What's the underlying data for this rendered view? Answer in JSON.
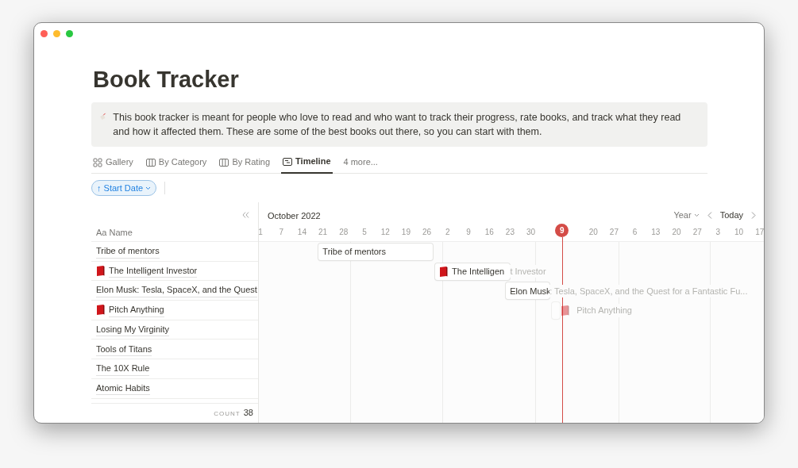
{
  "title": "Book Tracker",
  "callout": "This book tracker is meant for people who love to read and who want to track their progress, rate books, and track what they read and how it affected them. These are some of the best books out there, so you can start with them.",
  "views": [
    {
      "label": "Gallery",
      "kind": "gallery",
      "selected": false
    },
    {
      "label": "By Category",
      "kind": "board",
      "selected": false
    },
    {
      "label": "By Rating",
      "kind": "board",
      "selected": false
    },
    {
      "label": "Timeline",
      "kind": "timeline",
      "selected": true
    }
  ],
  "more_views": "4 more...",
  "sort": {
    "arrow": "↑",
    "label": "Start Date"
  },
  "name_header": {
    "icon_text": "Aa",
    "label": "Name"
  },
  "month": "October 2022",
  "scale": "Year",
  "today_button": "Today",
  "ticks": [
    {
      "label": "1",
      "today": false
    },
    {
      "label": "7",
      "today": false
    },
    {
      "label": "14",
      "today": false
    },
    {
      "label": "21",
      "today": false
    },
    {
      "label": "28",
      "today": false
    },
    {
      "label": "5",
      "today": false
    },
    {
      "label": "12",
      "today": false
    },
    {
      "label": "19",
      "today": false
    },
    {
      "label": "26",
      "today": false
    },
    {
      "label": "2",
      "today": false
    },
    {
      "label": "9",
      "today": false
    },
    {
      "label": "16",
      "today": false
    },
    {
      "label": "23",
      "today": false
    },
    {
      "label": "30",
      "today": false
    },
    {
      "label": "9",
      "today": true
    },
    {
      "label": "20",
      "today": false
    },
    {
      "label": "27",
      "today": false
    },
    {
      "label": "6",
      "today": false
    },
    {
      "label": "13",
      "today": false
    },
    {
      "label": "20",
      "today": false
    },
    {
      "label": "27",
      "today": false
    },
    {
      "label": "3",
      "today": false
    },
    {
      "label": "10",
      "today": false
    },
    {
      "label": "17",
      "today": false
    }
  ],
  "rows": [
    {
      "name": "Tribe of mentors",
      "book_icon": false
    },
    {
      "name": "The Intelligent Investor",
      "book_icon": true
    },
    {
      "name": "Elon Musk: Tesla, SpaceX, and the Quest",
      "book_icon": false
    },
    {
      "name": "Pitch Anything",
      "book_icon": true
    },
    {
      "name": "Losing My Virginity",
      "book_icon": false
    },
    {
      "name": "Tools of Titans",
      "book_icon": false
    },
    {
      "name": "The 10X Rule",
      "book_icon": false
    },
    {
      "name": "Atomic Habits",
      "book_icon": false
    }
  ],
  "bars": [
    {
      "inside": "Tribe of mentors",
      "book_icon": false,
      "faded": false
    },
    {
      "inside": "The Intelligen",
      "outside": "t Investor",
      "book_icon": true,
      "faded": false
    },
    {
      "inside": "Elon Musk",
      "outside": ": Tesla, SpaceX, and the Quest for a Fantastic Fu...",
      "book_icon": false,
      "faded": false
    },
    {
      "outside": "Pitch Anything",
      "book_icon": true,
      "faded": true
    }
  ],
  "count": {
    "label": "COUNT",
    "value": "38"
  }
}
